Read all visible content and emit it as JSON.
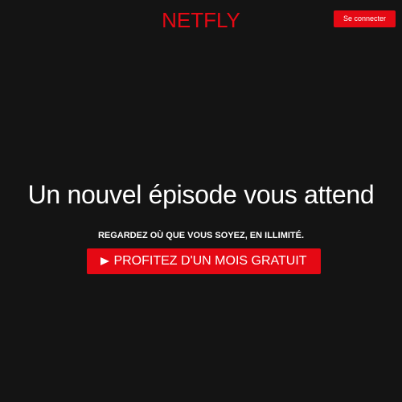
{
  "colors": {
    "background": "#141414",
    "accent": "#e50914",
    "button_bg": "#e50914",
    "text": "#ffffff"
  },
  "header": {
    "logo_text": "NETFLY",
    "signin_label": "Se connecter"
  },
  "hero": {
    "title": "Un nouvel épisode vous attend",
    "subtitle": "REGARDEZ OÙ QUE VOUS SOYEZ, EN ILLIMITÉ.",
    "cta_label": "PROFITEZ D'UN MOIS GRATUIT",
    "cta_icon": "play-icon"
  }
}
